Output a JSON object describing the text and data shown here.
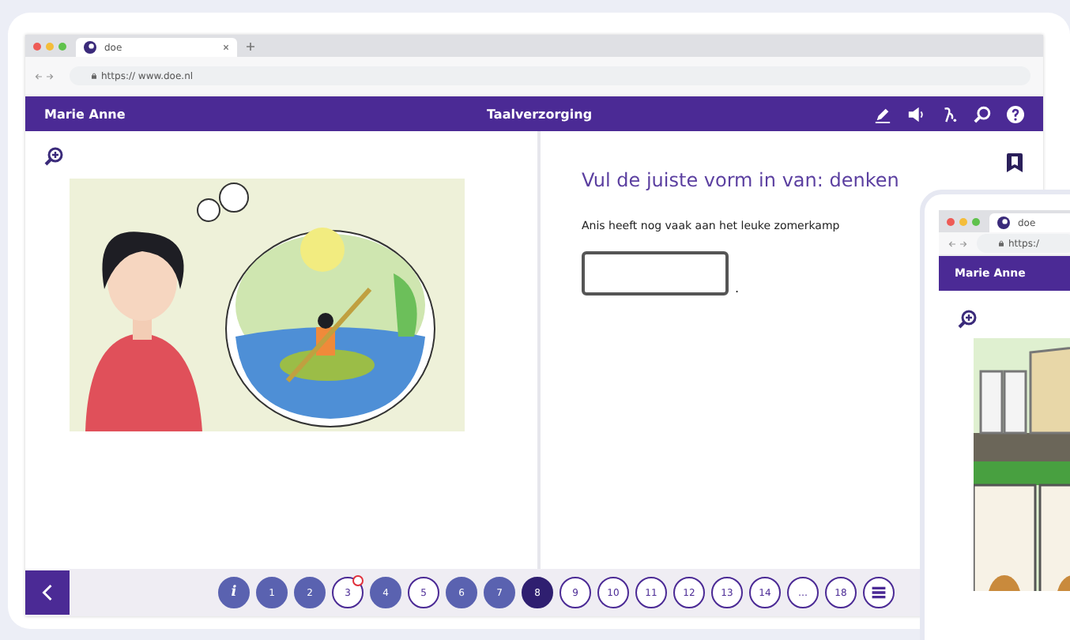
{
  "browser": {
    "tab_title": "doe",
    "url": "https:// www.doe.nl"
  },
  "header": {
    "user": "Marie Anne",
    "title": "Taalverzorging"
  },
  "exercise": {
    "question": "Vul de juiste vorm in van: denken",
    "sentence": "Anis heeft nog vaak aan het leuke zomerkamp",
    "answer_suffix": "."
  },
  "pagination": [
    {
      "label": "i",
      "done": true,
      "selected": false,
      "flagged": false
    },
    {
      "label": "1",
      "done": true,
      "selected": false,
      "flagged": false
    },
    {
      "label": "2",
      "done": true,
      "selected": false,
      "flagged": false
    },
    {
      "label": "3",
      "done": false,
      "selected": false,
      "flagged": true
    },
    {
      "label": "4",
      "done": true,
      "selected": false,
      "flagged": false
    },
    {
      "label": "5",
      "done": false,
      "selected": false,
      "flagged": false
    },
    {
      "label": "6",
      "done": true,
      "selected": false,
      "flagged": false
    },
    {
      "label": "7",
      "done": true,
      "selected": false,
      "flagged": false
    },
    {
      "label": "8",
      "done": false,
      "selected": true,
      "flagged": false
    },
    {
      "label": "9",
      "done": false,
      "selected": false,
      "flagged": false
    },
    {
      "label": "10",
      "done": false,
      "selected": false,
      "flagged": false
    },
    {
      "label": "11",
      "done": false,
      "selected": false,
      "flagged": false
    },
    {
      "label": "12",
      "done": false,
      "selected": false,
      "flagged": false
    },
    {
      "label": "13",
      "done": false,
      "selected": false,
      "flagged": false
    },
    {
      "label": "14",
      "done": false,
      "selected": false,
      "flagged": false
    },
    {
      "label": "…",
      "done": false,
      "selected": false,
      "flagged": false
    },
    {
      "label": "18",
      "done": false,
      "selected": false,
      "flagged": false
    }
  ],
  "tablet": {
    "tab_title": "doe",
    "url": "https:/",
    "user": "Marie Anne"
  }
}
